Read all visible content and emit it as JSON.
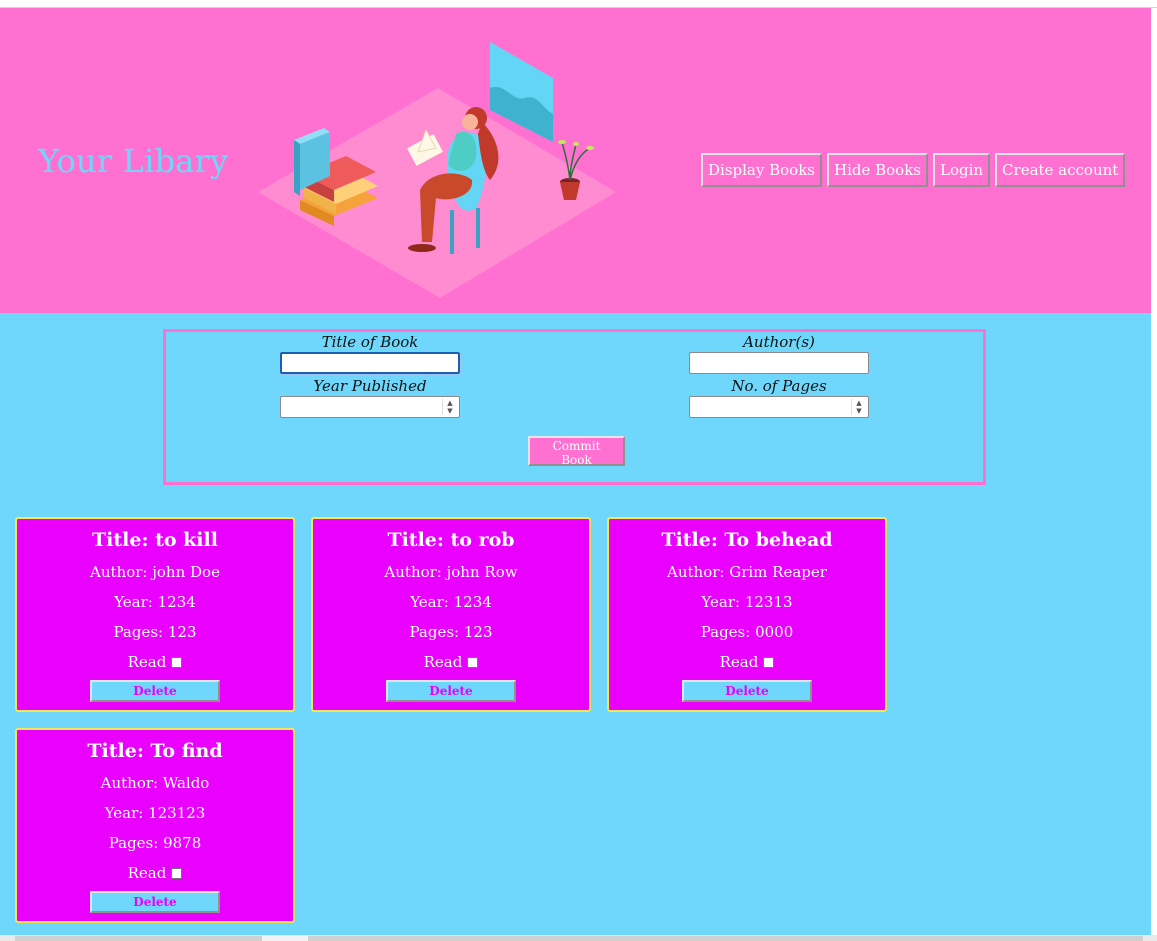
{
  "header": {
    "title": "Your Libary",
    "illustration": "woman-reading-books-illustration",
    "nav": [
      "Display Books",
      "Hide Books",
      "Login",
      "Create account"
    ]
  },
  "form": {
    "title_label": "Title of Book",
    "title_value": "",
    "author_label": "Author(s)",
    "author_value": "",
    "year_label": "Year Published",
    "year_value": "",
    "pages_label": "No. of Pages",
    "pages_value": "",
    "commit_label": "Commit Book"
  },
  "books": [
    {
      "title": "Title: to kill",
      "author": "Author: john Doe",
      "year": "Year: 1234",
      "pages": "Pages: 123",
      "read_label": "Read",
      "read": false,
      "delete_label": "Delete"
    },
    {
      "title": "Title: to rob",
      "author": "Author: john Row",
      "year": "Year: 1234",
      "pages": "Pages: 123",
      "read_label": "Read",
      "read": false,
      "delete_label": "Delete"
    },
    {
      "title": "Title: To behead",
      "author": "Author: Grim Reaper",
      "year": "Year: 12313",
      "pages": "Pages: 0000",
      "read_label": "Read",
      "read": false,
      "delete_label": "Delete"
    },
    {
      "title": "Title: To find",
      "author": "Author: Waldo",
      "year": "Year: 123123",
      "pages": "Pages: 9878",
      "read_label": "Read",
      "read": false,
      "delete_label": "Delete"
    }
  ],
  "colors": {
    "header_bg": "#ff70d1",
    "main_bg": "#6fd7fb",
    "card_bg": "#ea00ff",
    "card_border": "#f2e94e",
    "title_text": "#6fd7fb"
  }
}
